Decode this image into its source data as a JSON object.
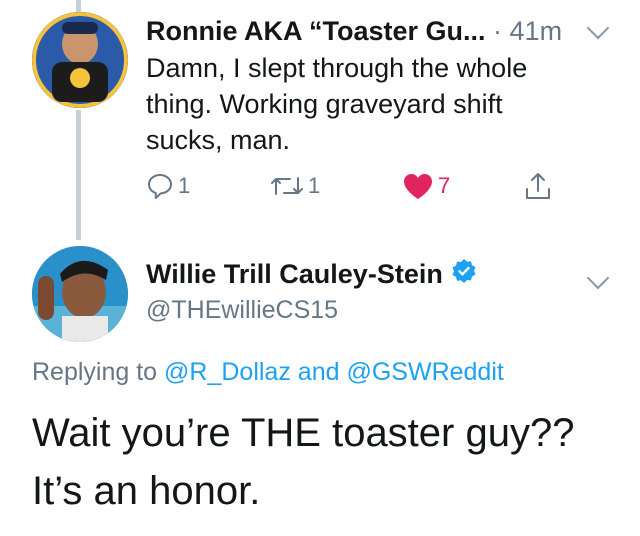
{
  "tweet1": {
    "author_name": "Ronnie AKA “Toaster Gu...",
    "time_meta": "· 41m",
    "body": "Damn, I slept through the whole thing. Working graveyard shift sucks, man.",
    "actions": {
      "reply_count": "1",
      "retweet_count": "1",
      "like_count": "7"
    }
  },
  "tweet2": {
    "author_name": "Willie Trill Cauley-Stein",
    "handle": "@THEwillieCS15",
    "replying_prefix": "Replying to",
    "mention1": "@R_Dollaz",
    "replying_and": "and",
    "mention2": "@GSWReddit",
    "body": "Wait you’re THE toaster guy?? It’s an honor."
  },
  "colors": {
    "like_red": "#e0245e",
    "link_blue": "#1da1f2",
    "muted_gray": "#657786",
    "thread_line": "#c4cfd6"
  },
  "icons": [
    "reply-icon",
    "retweet-icon",
    "heart-icon",
    "share-icon",
    "verified-badge-icon",
    "chevron-down-icon"
  ]
}
